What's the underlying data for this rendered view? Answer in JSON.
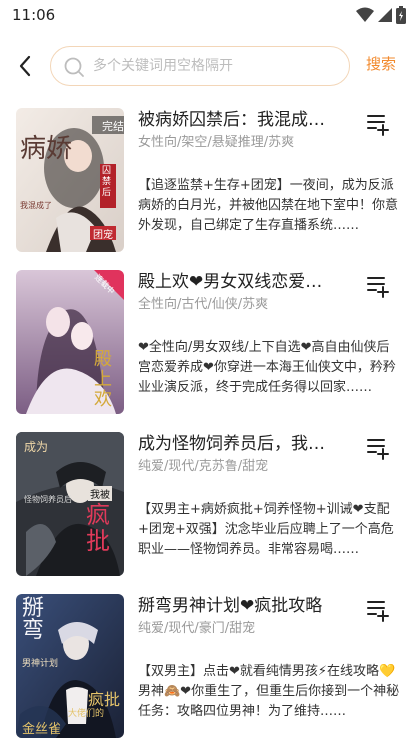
{
  "status_bar": {
    "time": "11:06",
    "icons": [
      "wifi-icon",
      "signal-icon",
      "battery-icon"
    ]
  },
  "search": {
    "placeholder": "多个关键词用空格隔开",
    "button_label": "搜索"
  },
  "colors": {
    "accent": "#f28a2e",
    "search_border": "#f3d6b8",
    "tag_text": "#9a9a9a"
  },
  "books": [
    {
      "title": "被病娇囚禁后：我混成了团宠",
      "tags": "女性向/架空/悬疑推理/苏爽",
      "description": "【追逐监禁+生存+团宠】一夜间，成为反派病娇的白月光，并被他囚禁在地下室中！你意外发现，自己绑定了生存直播系统……",
      "cover_badge": "完结",
      "cover_text": [
        "病娇",
        "囚禁后",
        "团宠",
        "我混成了"
      ]
    },
    {
      "title": "殿上欢❤男女双线恋爱养成",
      "tags": "全性向/古代/仙侠/苏爽",
      "description": "❤全性向/男女双线/上下自选❤高自由仙侠后宫恋爱养成❤你穿进一本海王仙侠文中，矜矜业业演反派，终于完成任务得以回家……",
      "cover_badge": "连载中",
      "cover_text": [
        "殿上欢"
      ]
    },
    {
      "title": "成为怪物饲养员后，我被疯批包围了",
      "tags": "纯爱/现代/克苏鲁/甜宠",
      "description": "【双男主+病娇疯批+饲养怪物+训诫❤支配+团宠+双强】沈念毕业后应聘上了一个高危职业——怪物饲养员。非常容易喝……",
      "cover_badge": "",
      "cover_text": [
        "成为",
        "怪物饲养员后",
        "我被",
        "疯批"
      ]
    },
    {
      "title": "掰弯男神计划❤疯批攻略",
      "tags": "纯爱/现代/豪门/甜宠",
      "description": "【双男主】点击❤就看纯情男孩⚡在线攻略💛男神🙈❤你重生了，但重生后你接到一个神秘任务：攻略四位男神！为了维持……",
      "cover_badge": "",
      "cover_text": [
        "掰弯",
        "男神计划",
        "疯批",
        "大佬们的",
        "金丝雀"
      ]
    }
  ]
}
